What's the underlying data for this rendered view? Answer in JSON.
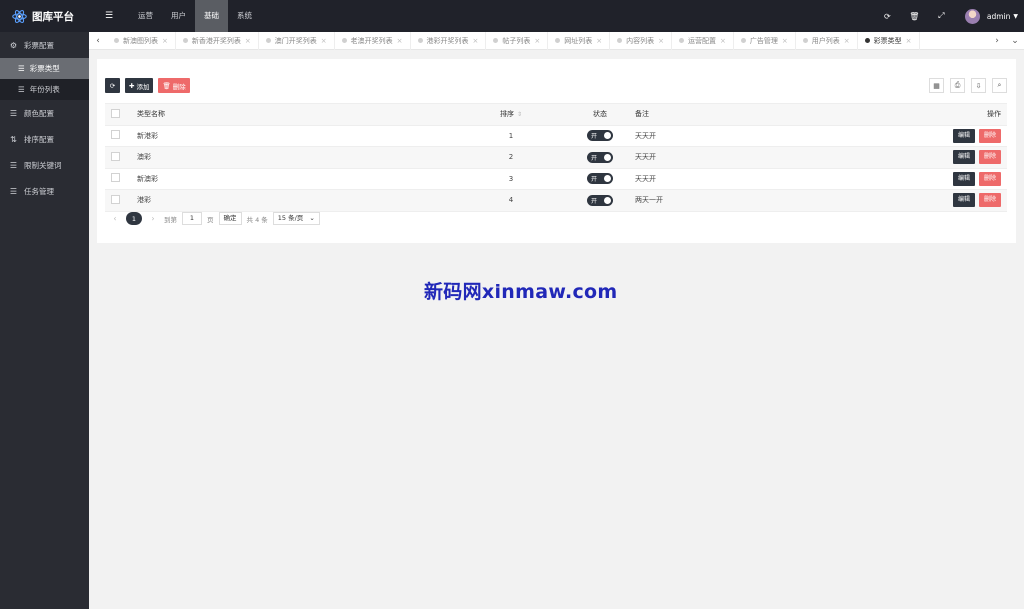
{
  "app": {
    "title": "图库平台"
  },
  "topnav": {
    "items": [
      {
        "label": "运营",
        "active": false
      },
      {
        "label": "用户",
        "active": false
      },
      {
        "label": "基础",
        "active": true
      },
      {
        "label": "系统",
        "active": false
      }
    ],
    "user": "admin"
  },
  "sidebar": {
    "group": "彩票配置",
    "sub_items": [
      {
        "label": "彩票类型",
        "active": true
      },
      {
        "label": "年份列表",
        "active": false
      }
    ],
    "items": [
      {
        "label": "颜色配置"
      },
      {
        "label": "排序配置"
      },
      {
        "label": "限制关键词"
      },
      {
        "label": "任务管理"
      }
    ]
  },
  "tabs": [
    "新澳图列表",
    "新香港开奖列表",
    "澳门开奖列表",
    "老澳开奖列表",
    "港彩开奖列表",
    "帖子列表",
    "网址列表",
    "内容列表",
    "运营配置",
    "广告管理",
    "用户列表",
    "彩票类型"
  ],
  "active_tab_index": 11,
  "toolbar": {
    "add_label": "添加",
    "delete_label": "删除"
  },
  "table": {
    "headers": {
      "name": "类型名称",
      "sort": "排序",
      "status": "状态",
      "remark": "备注",
      "op": "操作"
    },
    "rows": [
      {
        "name": "新港彩",
        "sort": "1",
        "status": "开",
        "remark": "天天开"
      },
      {
        "name": "澳彩",
        "sort": "2",
        "status": "开",
        "remark": "天天开"
      },
      {
        "name": "新澳彩",
        "sort": "3",
        "status": "开",
        "remark": "天天开"
      },
      {
        "name": "港彩",
        "sort": "4",
        "status": "开",
        "remark": "两天一开"
      }
    ],
    "edit_label": "编辑",
    "delete_label": "删除"
  },
  "pager": {
    "current": "1",
    "goto_label": "到第",
    "goto_value": "1",
    "page_unit": "页",
    "confirm": "确定",
    "total": "共 4 条",
    "per_page": "15 条/页"
  },
  "watermark": "新码网xinmaw.com",
  "colors": {
    "sidebar_bg": "#2a2c33",
    "topbar_bg": "#20222a",
    "primary_btn": "#2f3640",
    "danger_btn": "#ee6a6a",
    "watermark": "#2128b8"
  }
}
